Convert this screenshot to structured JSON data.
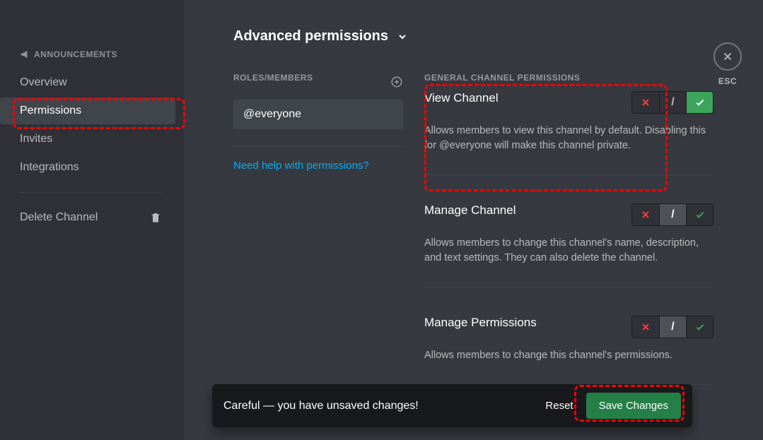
{
  "sidebar": {
    "channel_label": "ANNOUNCEMENTS",
    "items": [
      {
        "label": "Overview",
        "active": false
      },
      {
        "label": "Permissions",
        "active": true
      },
      {
        "label": "Invites",
        "active": false
      },
      {
        "label": "Integrations",
        "active": false
      }
    ],
    "delete_label": "Delete Channel"
  },
  "main": {
    "title": "Advanced permissions",
    "roles_label": "ROLES/MEMBERS",
    "role_selected": "@everyone",
    "help_link": "Need help with permissions?",
    "perm_section_label": "GENERAL CHANNEL PERMISSIONS",
    "permissions": [
      {
        "title": "View Channel",
        "desc": "Allows members to view this channel by default. Disabling this for @everyone will make this channel private.",
        "state": "allow"
      },
      {
        "title": "Manage Channel",
        "desc": "Allows members to change this channel's name, description, and text settings. They can also delete the channel.",
        "state": "neutral"
      },
      {
        "title": "Manage Permissions",
        "desc": "Allows members to change this channel's permissions.",
        "state": "neutral"
      }
    ]
  },
  "close": {
    "label": "ESC"
  },
  "unsaved": {
    "text": "Careful — you have unsaved changes!",
    "reset": "Reset",
    "save": "Save Changes"
  }
}
